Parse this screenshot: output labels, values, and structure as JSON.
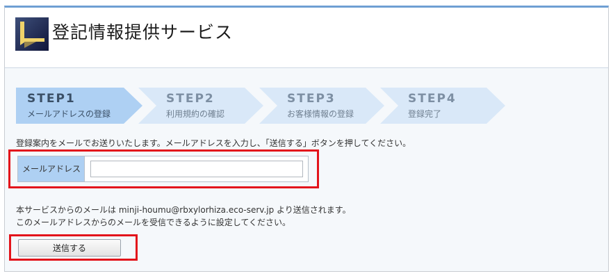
{
  "header": {
    "title": "登記情報提供サービス",
    "logo_icon": "tower-logo-icon"
  },
  "steps": [
    {
      "number": "STEP1",
      "label": "メールアドレスの登録",
      "active": true
    },
    {
      "number": "STEP2",
      "label": "利用規約の確認",
      "active": false
    },
    {
      "number": "STEP3",
      "label": "お客様情報の登録",
      "active": false
    },
    {
      "number": "STEP4",
      "label": "登録完了",
      "active": false
    }
  ],
  "instruction": "登録案内をメールでお送りいたします。メールアドレスを入力し、「送信する」ボタンを押してください。",
  "email": {
    "label": "メールアドレス",
    "value": "",
    "placeholder": ""
  },
  "notice": {
    "line1": "本サービスからのメールは minji-houmu@rbxylorhiza.eco-serv.jp より送信されます。",
    "line2": "このメールアドレスからのメールを受信できるように設定してください。"
  },
  "submit_label": "送信する",
  "colors": {
    "accent": "#6f9fd3",
    "step_active": "#aed0f3",
    "step_inactive": "#d9e8f8",
    "highlight": "#e3141b"
  }
}
